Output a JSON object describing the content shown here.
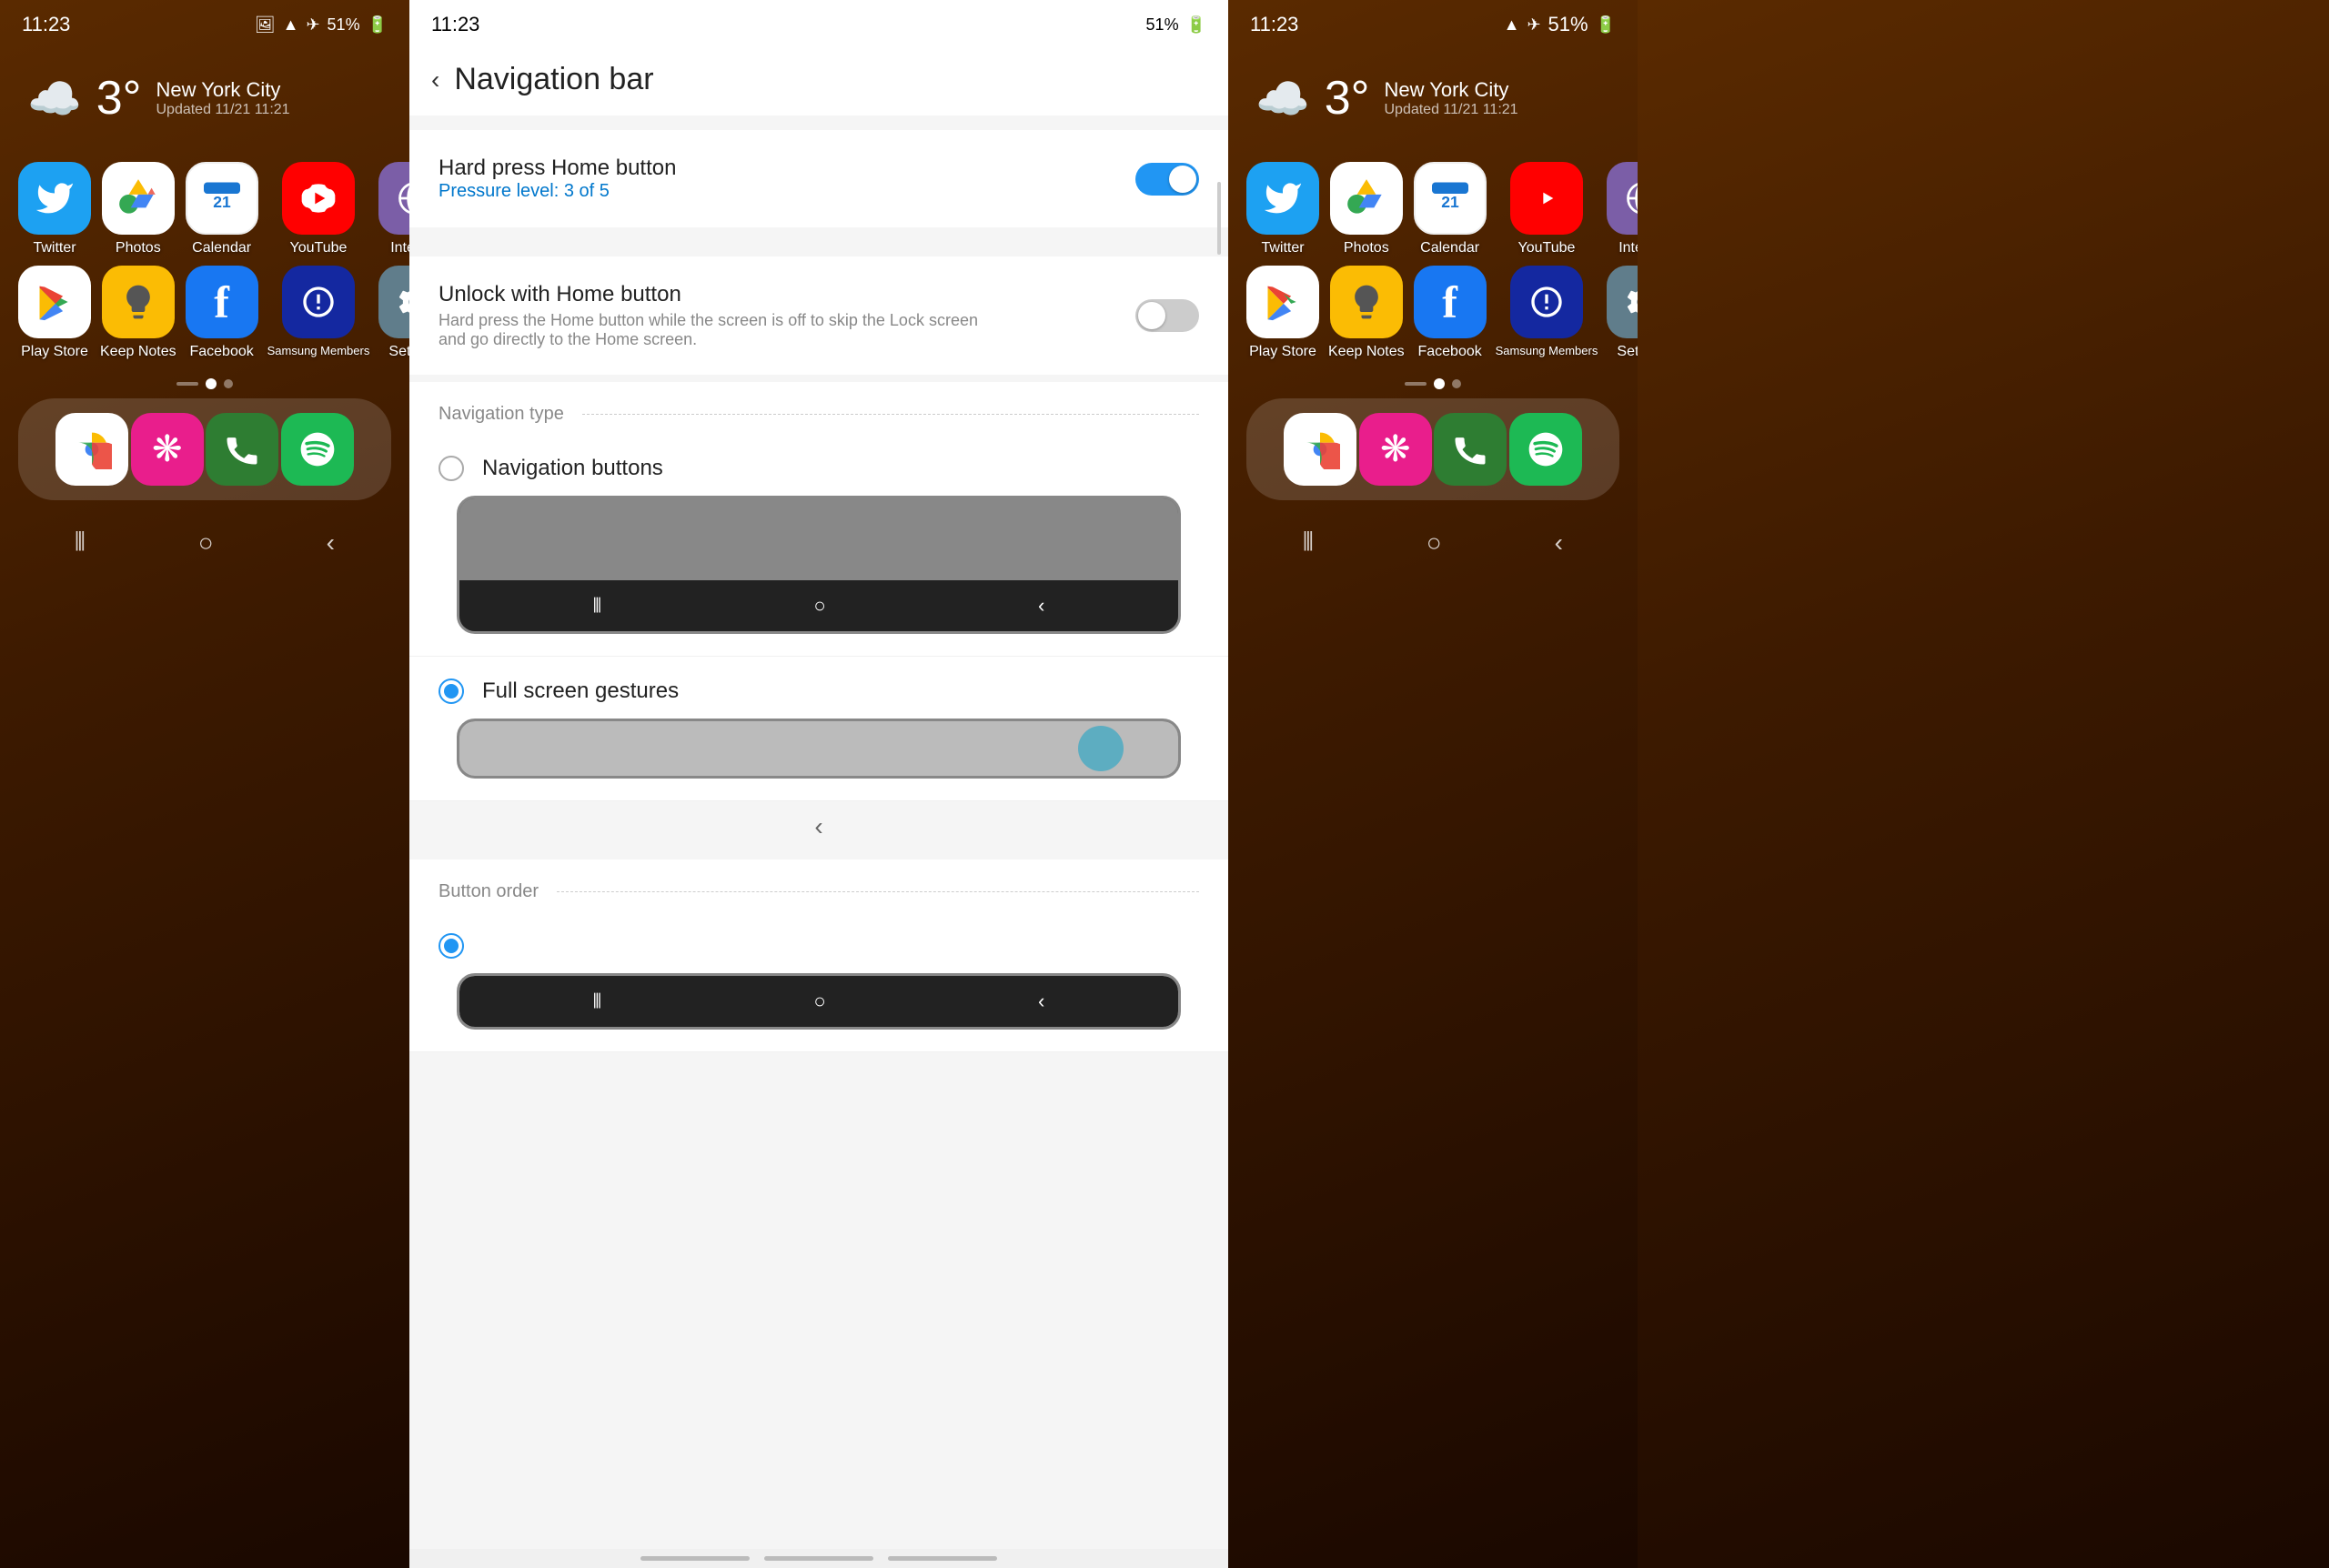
{
  "leftPanel": {
    "statusBar": {
      "time": "11:23",
      "battery": "51%"
    },
    "weather": {
      "temp": "3°",
      "city": "New York City",
      "updated": "Updated 11/21 11:21"
    },
    "row1Apps": [
      {
        "id": "twitter",
        "label": "Twitter",
        "iconClass": "icon-twitter"
      },
      {
        "id": "photos",
        "label": "Photos",
        "iconClass": "icon-photos"
      },
      {
        "id": "calendar",
        "label": "Calendar",
        "iconClass": "icon-calendar"
      },
      {
        "id": "youtube",
        "label": "YouTube",
        "iconClass": "icon-youtube"
      },
      {
        "id": "internet",
        "label": "Internet",
        "iconClass": "icon-internet"
      }
    ],
    "row2Apps": [
      {
        "id": "playstore",
        "label": "Play Store",
        "iconClass": "icon-playstore"
      },
      {
        "id": "keepnotes",
        "label": "Keep Notes",
        "iconClass": "icon-keepnotes"
      },
      {
        "id": "facebook",
        "label": "Facebook",
        "iconClass": "icon-facebook"
      },
      {
        "id": "samsung",
        "label": "Samsung Members",
        "iconClass": "icon-samsung"
      },
      {
        "id": "settings",
        "label": "Settings",
        "iconClass": "icon-settings"
      }
    ],
    "dockApps": [
      {
        "id": "chrome",
        "label": "",
        "iconClass": "icon-chrome"
      },
      {
        "id": "petal",
        "label": "",
        "iconClass": "icon-petal"
      },
      {
        "id": "phone",
        "label": "",
        "iconClass": "icon-phone"
      },
      {
        "id": "spotify",
        "label": "",
        "iconClass": "icon-spotify"
      }
    ]
  },
  "centerPanel": {
    "statusBar": {
      "time": "11:23"
    },
    "header": {
      "backLabel": "←",
      "title": "Navigation bar"
    },
    "hardPressHome": {
      "title": "Hard press Home button",
      "subtitle": "Pressure level: 3 of 5",
      "toggleOn": true
    },
    "unlockWithHome": {
      "title": "Unlock with Home button",
      "description": "Hard press the Home button while the screen is off to skip the Lock screen and go directly to the Home screen.",
      "toggleOn": false
    },
    "navigationTypeSection": {
      "label": "Navigation type"
    },
    "navButtons": {
      "label": "Navigation buttons",
      "selected": false
    },
    "fullScreenGestures": {
      "label": "Full screen gestures",
      "selected": true
    },
    "buttonOrderSection": {
      "label": "Button order"
    }
  },
  "rightPanel": {
    "statusBar": {
      "time": "11:23",
      "battery": "51%"
    },
    "weather": {
      "temp": "3°",
      "city": "New York City",
      "updated": "Updated 11/21 11:21"
    },
    "row1Apps": [
      {
        "id": "twitter-r",
        "label": "Twitter",
        "iconClass": "icon-twitter"
      },
      {
        "id": "photos-r",
        "label": "Photos",
        "iconClass": "icon-photos"
      },
      {
        "id": "calendar-r",
        "label": "Calendar",
        "iconClass": "icon-calendar"
      },
      {
        "id": "youtube-r",
        "label": "YouTube",
        "iconClass": "icon-youtube"
      },
      {
        "id": "internet-r",
        "label": "Internet",
        "iconClass": "icon-internet"
      }
    ],
    "row2Apps": [
      {
        "id": "playstore-r",
        "label": "Play Store",
        "iconClass": "icon-playstore"
      },
      {
        "id": "keepnotes-r",
        "label": "Keep Notes",
        "iconClass": "icon-keepnotes"
      },
      {
        "id": "facebook-r",
        "label": "Facebook",
        "iconClass": "icon-facebook"
      },
      {
        "id": "samsung-r",
        "label": "Samsung Members",
        "iconClass": "icon-samsung"
      },
      {
        "id": "settings-r",
        "label": "Settings",
        "iconClass": "icon-settings"
      }
    ],
    "dockApps": [
      {
        "id": "chrome-r",
        "label": "",
        "iconClass": "icon-chrome"
      },
      {
        "id": "petal-r",
        "label": "",
        "iconClass": "icon-petal"
      },
      {
        "id": "phone-r",
        "label": "",
        "iconClass": "icon-phone"
      },
      {
        "id": "spotify-r",
        "label": "",
        "iconClass": "icon-spotify"
      }
    ]
  }
}
